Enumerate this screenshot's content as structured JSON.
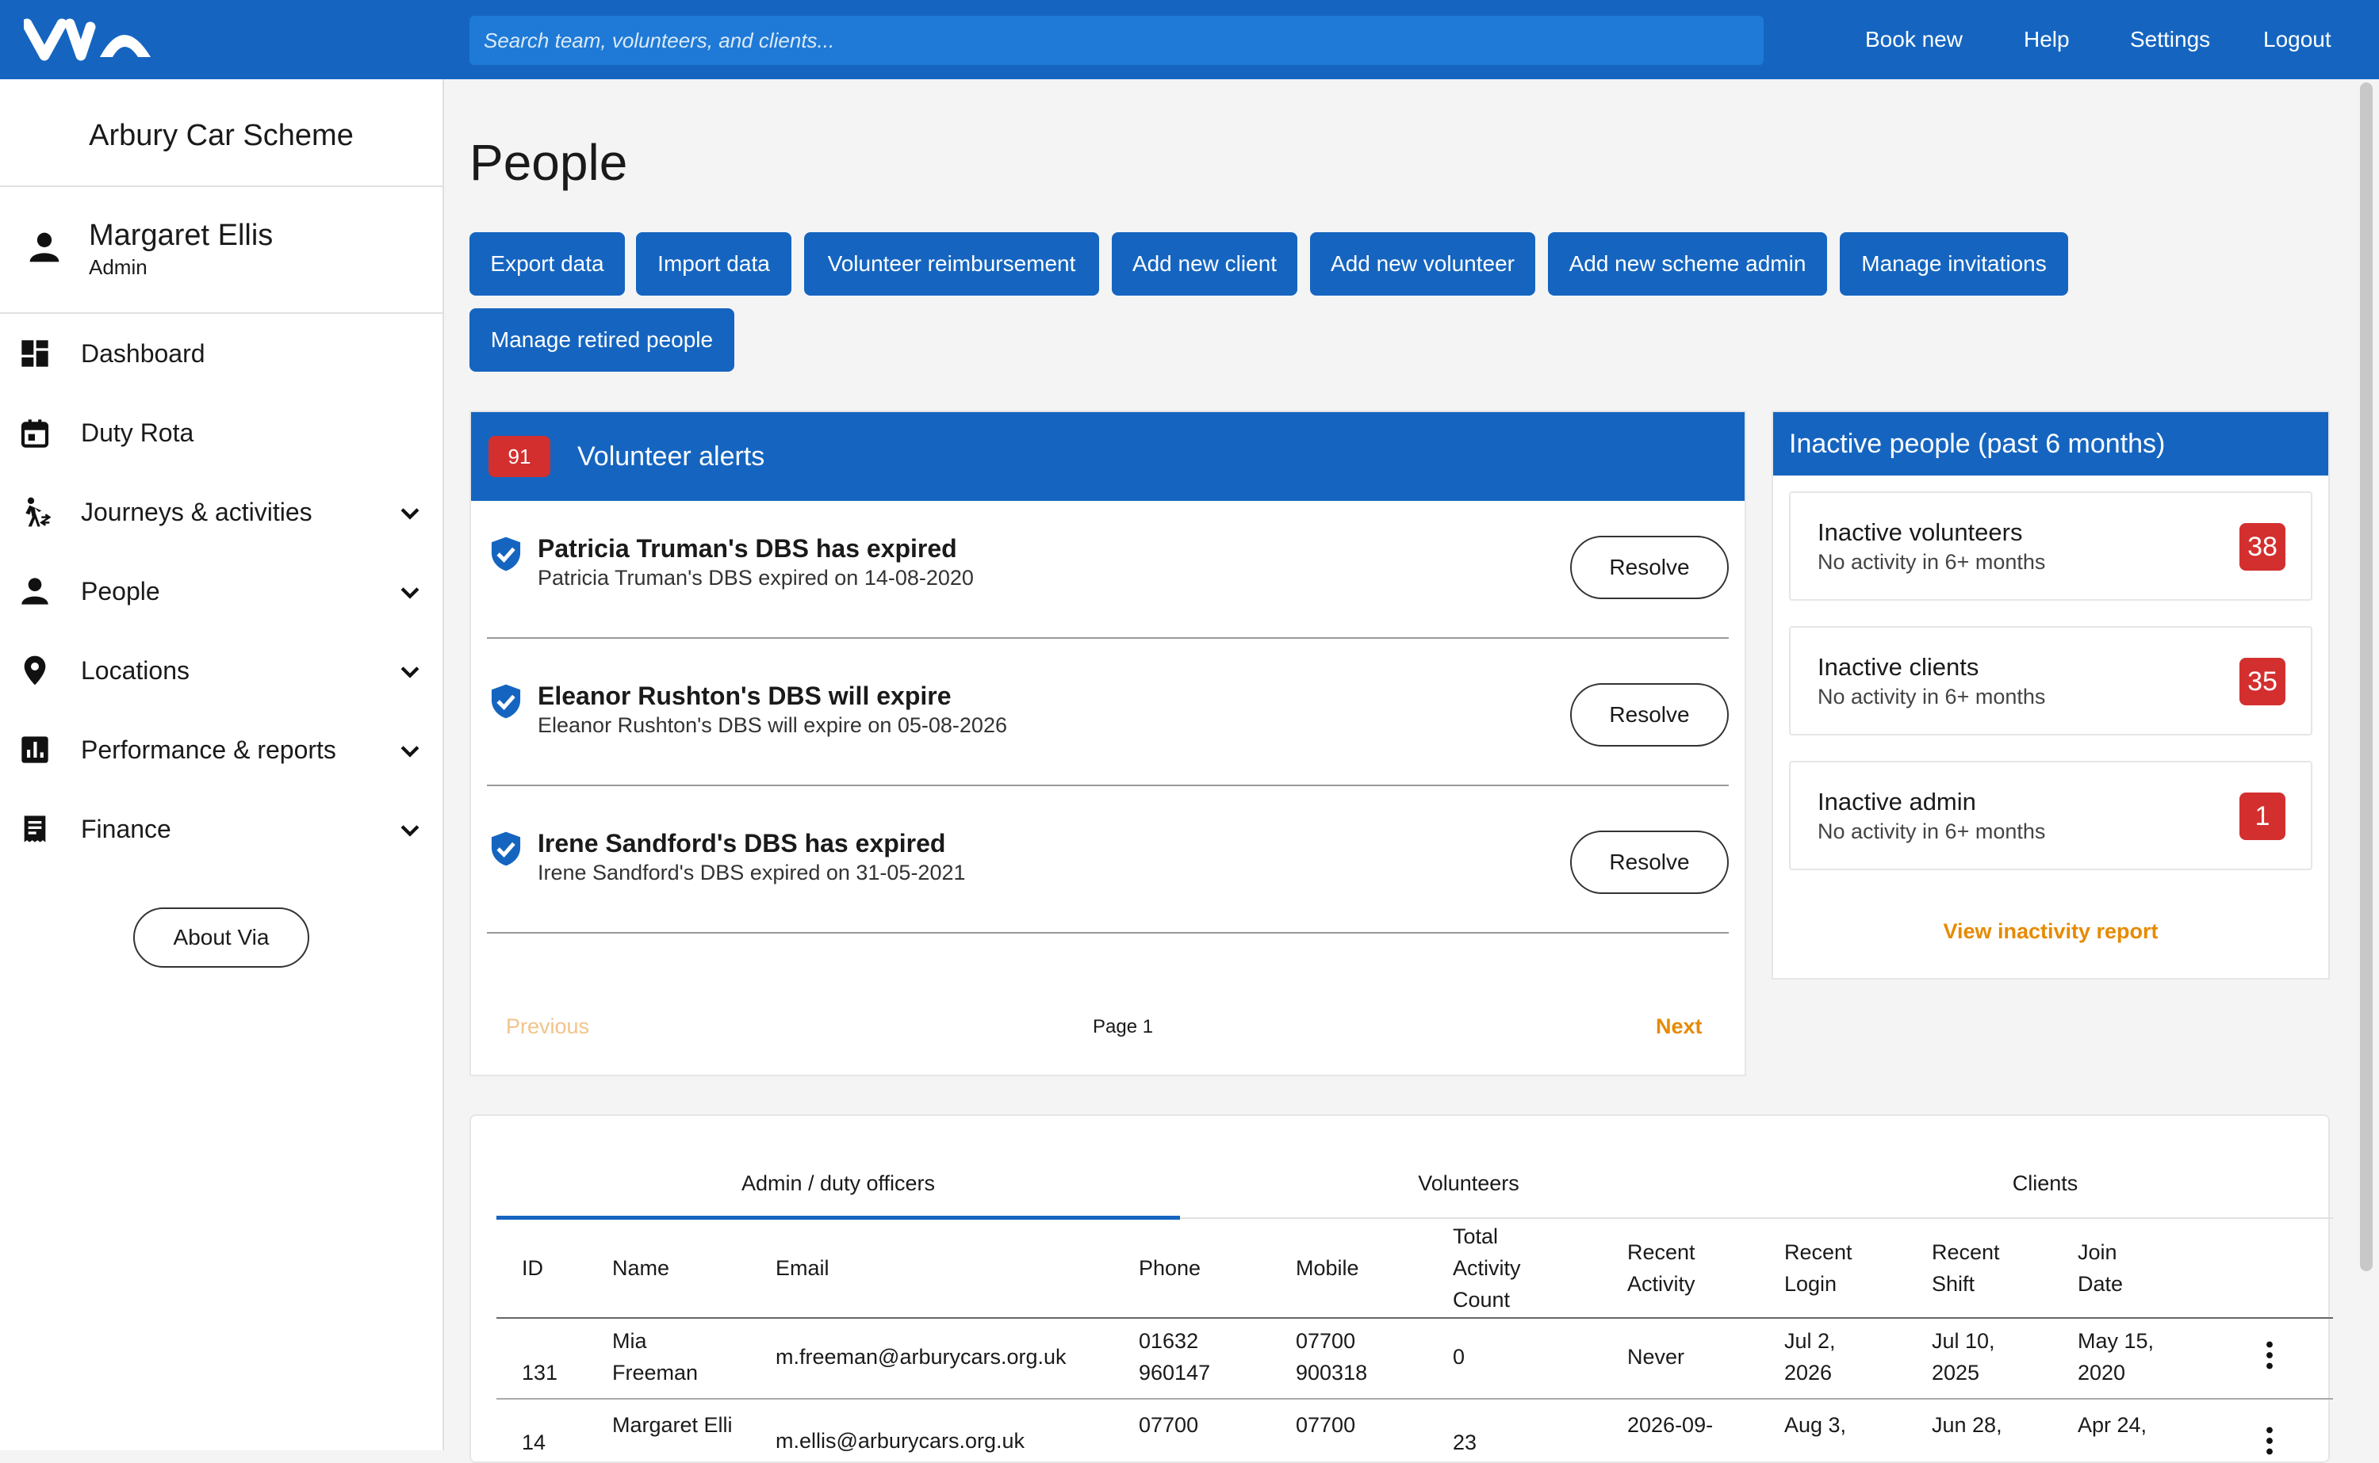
{
  "topbar": {
    "search_placeholder": "Search team, volunteers, and clients...",
    "nav": [
      "Book new",
      "Help",
      "Settings",
      "Logout"
    ]
  },
  "sidebar": {
    "scheme_name": "Arbury Car Scheme",
    "user": {
      "name": "Margaret Ellis",
      "role": "Admin"
    },
    "items": [
      {
        "label": "Dashboard",
        "icon": "dashboard-icon",
        "expandable": false
      },
      {
        "label": "Duty Rota",
        "icon": "calendar-icon",
        "expandable": false
      },
      {
        "label": "Journeys & activities",
        "icon": "walking-icon",
        "expandable": true
      },
      {
        "label": "People",
        "icon": "person-icon",
        "expandable": true
      },
      {
        "label": "Locations",
        "icon": "location-pin-icon",
        "expandable": true
      },
      {
        "label": "Performance & reports",
        "icon": "bar-chart-icon",
        "expandable": true
      },
      {
        "label": "Finance",
        "icon": "receipt-icon",
        "expandable": true
      }
    ],
    "about_label": "About Via"
  },
  "page": {
    "title": "People",
    "actions": [
      "Export data",
      "Import data",
      "Volunteer reimbursement",
      "Add new client",
      "Add new volunteer",
      "Add new scheme admin",
      "Manage invitations",
      "Manage retired people"
    ]
  },
  "alerts": {
    "count": "91",
    "title": "Volunteer alerts",
    "items": [
      {
        "title": "Patricia Truman's DBS has expired",
        "desc": "Patricia Truman's DBS expired on 14-08-2020"
      },
      {
        "title": "Eleanor Rushton's DBS will expire",
        "desc": "Eleanor Rushton's DBS will expire on 05-08-2026"
      },
      {
        "title": "Irene Sandford's DBS has expired",
        "desc": "Irene Sandford's DBS expired on 31-05-2021"
      }
    ],
    "resolve_label": "Resolve",
    "pager": {
      "previous": "Previous",
      "page": "Page 1",
      "next": "Next"
    }
  },
  "inactive": {
    "title": "Inactive people (past 6 months)",
    "items": [
      {
        "title": "Inactive volunteers",
        "sub": "No activity in 6+ months",
        "count": "38"
      },
      {
        "title": "Inactive clients",
        "sub": "No activity in 6+ months",
        "count": "35"
      },
      {
        "title": "Inactive admin",
        "sub": "No activity in 6+ months",
        "count": "1"
      }
    ],
    "report_link": "View inactivity report"
  },
  "people_table": {
    "tabs": [
      "Admin / duty officers",
      "Volunteers",
      "Clients"
    ],
    "active_tab": "Admin / duty officers",
    "columns": [
      "ID",
      "Name",
      "Email",
      "Phone",
      "Mobile",
      "Total Activity Count",
      "Recent Activity",
      "Recent Login",
      "Recent Shift",
      "Join Date"
    ],
    "rows": [
      {
        "id": "131",
        "name": "Mia Freeman",
        "email": "m.freeman@arburycars.org.uk",
        "phone": "01632 960147",
        "mobile": "07700 900318",
        "total": "0",
        "recent_activity": "Never",
        "recent_login": "Jul 2, 2026",
        "recent_shift": "Jul 10, 2025",
        "join_date": "May 15, 2020"
      },
      {
        "id": "14",
        "name": "Margaret Elli",
        "email": "m.ellis@arburycars.org.uk",
        "phone": "07700",
        "mobile": "07700",
        "total": "23",
        "recent_activity": "2026-09-",
        "recent_login": "Aug 3,",
        "recent_shift": "Jun 28,",
        "join_date": "Apr 24,"
      }
    ]
  },
  "colors": {
    "primary": "#1565c0",
    "alert_red": "#d32f2f",
    "link_orange": "#e68a00"
  }
}
